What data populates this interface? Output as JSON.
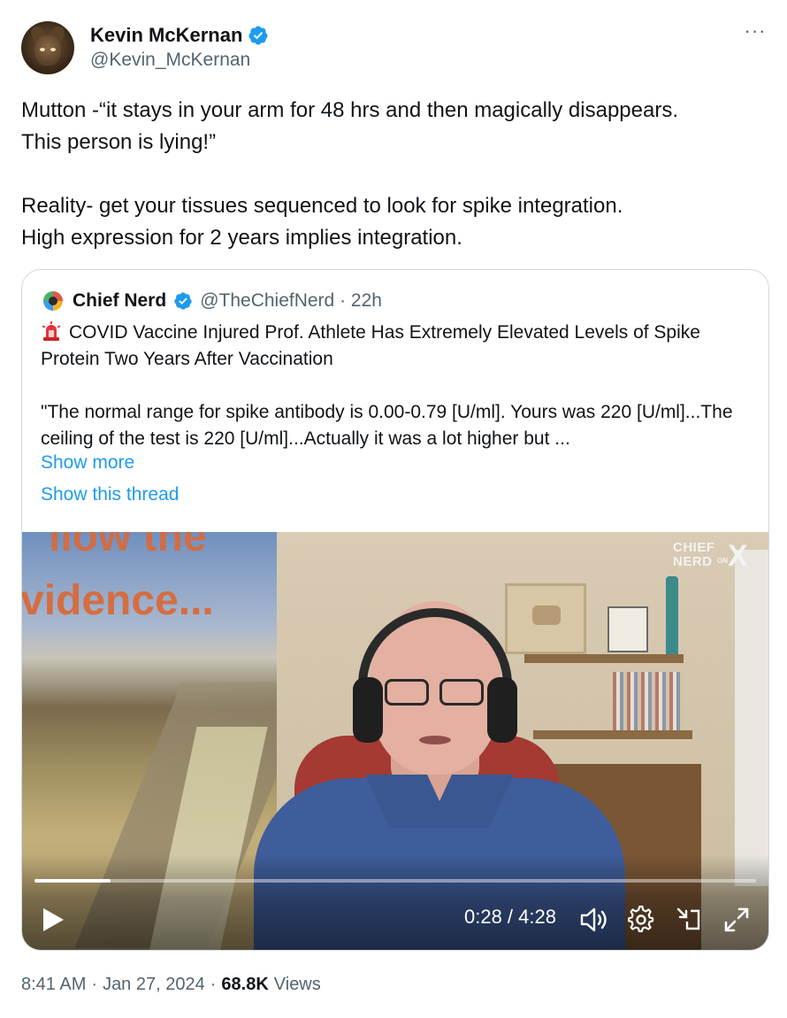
{
  "author": {
    "display_name": "Kevin McKernan",
    "handle": "@Kevin_McKernan",
    "avatar_icon": "owl-avatar",
    "verified_icon": "verified-badge-icon",
    "verified_color": "#1d9bf0"
  },
  "more_icon": "ellipsis-icon",
  "more_label": "···",
  "tweet": {
    "paragraph1": "Mutton -“it stays in your arm for 48 hrs and then magically disappears.\nThis person is lying!”",
    "paragraph2": "Reality- get your tissues sequenced to look for spike integration.\nHigh expression for 2 years implies integration."
  },
  "quote": {
    "display_name": "Chief Nerd",
    "handle_time": "@TheChiefNerd · 22h",
    "headline": "COVID Vaccine Injured Prof. Athlete Has Extremely Elevated Levels of Spike Protein Two Years After Vaccination",
    "headline_icon": "police-light-icon",
    "body": "\"The normal range for spike antibody is 0.00-0.79 [U/ml]. Yours was 220 [U/ml]...The ceiling of the test is 220 [U/ml]...Actually it was a lot higher but ...",
    "show_more": "Show more",
    "show_thread": "Show this thread",
    "link_color": "#1d9bf0"
  },
  "video": {
    "overlay_text_1": "llow the",
    "overlay_text_2": "vidence...",
    "logo_line1": "CHIEF",
    "logo_line2": "NERD",
    "logo_on": "ON",
    "logo_x": "X",
    "time": "0:28 / 4:28",
    "progress_fraction": 0.105,
    "icons": [
      "play-icon",
      "volume-icon",
      "settings-gear-icon",
      "dock-icon",
      "fullscreen-icon"
    ]
  },
  "footer": {
    "time": "8:41 AM",
    "sep1": "·",
    "date": "Jan 27, 2024",
    "sep2": "·",
    "views_count": "68.8K",
    "views_label": "Views"
  }
}
